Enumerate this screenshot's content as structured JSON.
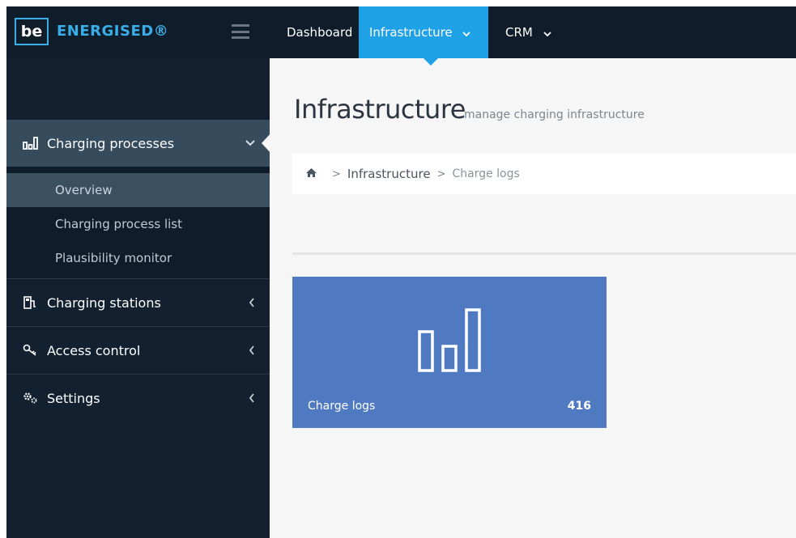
{
  "brand": {
    "mark": "be",
    "word": "ENERGISED®"
  },
  "topnav": {
    "items": [
      {
        "label": "Dashboard"
      },
      {
        "label": "Infrastructure",
        "caret": "˅"
      },
      {
        "label": "CRM",
        "caret": "˅"
      }
    ]
  },
  "sidebar": {
    "groups": [
      {
        "label": "Charging processes",
        "icon": "bar-chart-icon",
        "expanded": true,
        "children": [
          {
            "label": "Overview",
            "selected": true
          },
          {
            "label": "Charging process list"
          },
          {
            "label": "Plausibility monitor"
          }
        ]
      },
      {
        "label": "Charging stations",
        "icon": "charging-station-icon"
      },
      {
        "label": "Access control",
        "icon": "key-icon"
      },
      {
        "label": "Settings",
        "icon": "gears-icon"
      }
    ]
  },
  "page": {
    "title": "Infrastructure",
    "subtitle": "manage charging infrastructure"
  },
  "breadcrumb": {
    "items": [
      "Infrastructure",
      "Charge logs"
    ]
  },
  "tile": {
    "label": "Charge logs",
    "count": "416",
    "icon": "bar-chart-icon"
  },
  "colors": {
    "sidebar_bg": "#12202f",
    "active_nav": "#1ea1e6",
    "tile_bg": "#4f7ac1",
    "brand_accent": "#3aaee6"
  }
}
